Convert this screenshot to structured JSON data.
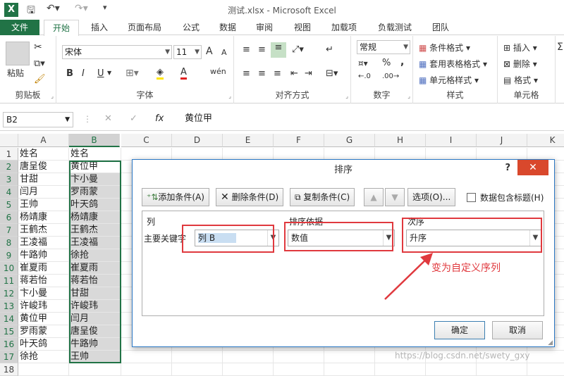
{
  "window": {
    "title": "测试.xlsx - Microsoft Excel",
    "app_logo": "X"
  },
  "tabs": [
    "文件",
    "开始",
    "插入",
    "页面布局",
    "公式",
    "数据",
    "审阅",
    "视图",
    "加载项",
    "负载测试",
    "团队"
  ],
  "ribbon": {
    "clipboard": {
      "label": "剪贴板",
      "paste": "粘贴"
    },
    "font": {
      "label": "字体",
      "name": "宋体",
      "size": "11",
      "bold": "B",
      "italic": "I",
      "underline": "U",
      "grow": "A",
      "shrink": "A",
      "wen": "wén"
    },
    "alignment": {
      "label": "对齐方式"
    },
    "number": {
      "label": "数字",
      "format": "常规",
      "percent": "%",
      "comma": ","
    },
    "styles": {
      "label": "样式",
      "cond": "条件格式",
      "table": "套用表格格式",
      "cell": "单元格样式"
    },
    "cells": {
      "label": "单元格",
      "insert": "插入",
      "delete": "删除",
      "format": "格式"
    }
  },
  "formula_bar": {
    "name_box": "B2",
    "fx": "fx",
    "value": "黄位甲"
  },
  "grid": {
    "columns": [
      "A",
      "B",
      "C",
      "D",
      "E",
      "F",
      "G",
      "H",
      "I",
      "J",
      "K"
    ],
    "rows": [
      "1",
      "2",
      "3",
      "4",
      "5",
      "6",
      "7",
      "8",
      "9",
      "10",
      "11",
      "12",
      "13",
      "14",
      "15",
      "16",
      "17",
      "18"
    ],
    "colA": [
      "姓名",
      "唐呈俊",
      "甘甜",
      "闫月",
      "王帅",
      "杨靖康",
      "王鹤杰",
      "王凌福",
      "牛路帅",
      "崔夏雨",
      "蒋若怡",
      "卞小曼",
      "许峻玮",
      "黄位甲",
      "罗雨蒙",
      "叶天鸽",
      "徐抢",
      ""
    ],
    "colB": [
      "姓名",
      "黄位甲",
      "卞小曼",
      "罗雨蒙",
      "叶天鸽",
      "杨靖康",
      "王鹤杰",
      "王凌福",
      "徐抢",
      "崔夏雨",
      "蒋若怡",
      "甘甜",
      "许峻玮",
      "闫月",
      "唐呈俊",
      "牛路帅",
      "王帅",
      ""
    ]
  },
  "dialog": {
    "title": "排序",
    "help": "?",
    "close": "✕",
    "add": "添加条件(A)",
    "delete": "删除条件(D)",
    "copy": "复制条件(C)",
    "options": "选项(O)...",
    "header_check": "数据包含标题(H)",
    "col_header": "列",
    "basis_header": "排序依据",
    "order_header": "次序",
    "row_label": "主要关键字",
    "column_value": "列 B",
    "basis_value": "数值",
    "order_value": "升序",
    "ok": "确定",
    "cancel": "取消"
  },
  "annotation": {
    "text": "变为自定义序列",
    "color": "#e0393e"
  },
  "watermark": "https://blog.csdn.net/swety_gxy"
}
